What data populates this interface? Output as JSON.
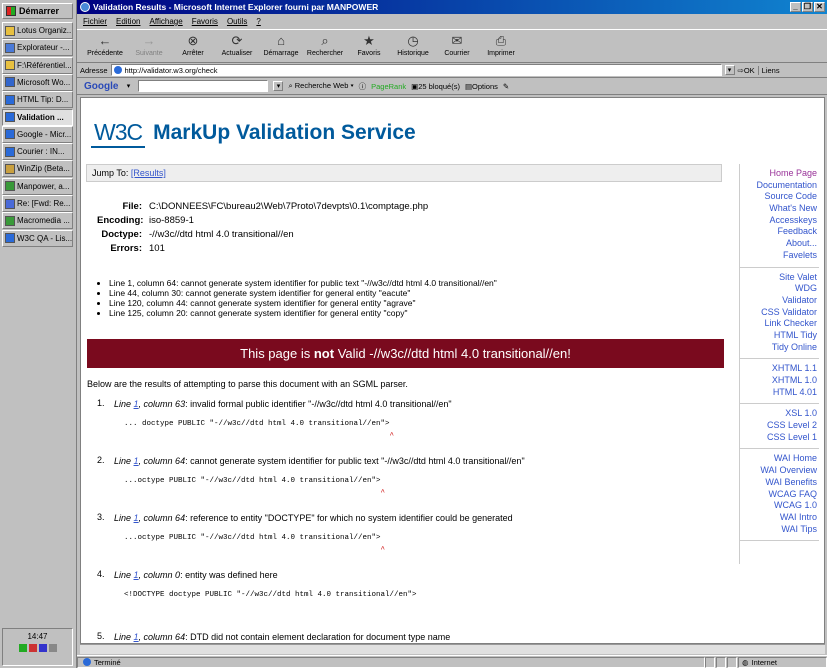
{
  "taskbar": {
    "start_label": "Démarrer",
    "items": [
      {
        "label": "Lotus Organiz..."
      },
      {
        "label": "Explorateur -..."
      },
      {
        "label": "F:\\Référentiel..."
      },
      {
        "label": "Microsoft Wo..."
      },
      {
        "label": "HTML Tip: D..."
      },
      {
        "label": "Validation ...",
        "active": true
      },
      {
        "label": "Google - Micr..."
      },
      {
        "label": "Courier : IN..."
      },
      {
        "label": "WinZip (Beta..."
      },
      {
        "label": "Manpower, a..."
      },
      {
        "label": "Re: [Fwd: Re..."
      },
      {
        "label": "Macromedia ..."
      },
      {
        "label": "W3C QA - Lis..."
      }
    ],
    "clock": "14:47"
  },
  "window": {
    "title": "Validation Results - Microsoft Internet Explorer fourni par MANPOWER",
    "menu": [
      "Fichier",
      "Edition",
      "Affichage",
      "Favoris",
      "Outils",
      "?"
    ],
    "toolbar": [
      {
        "label": "Précédente",
        "icon": "back-arrow-icon",
        "glyph": "←"
      },
      {
        "label": "Suivante",
        "icon": "forward-arrow-icon",
        "glyph": "→",
        "disabled": true
      },
      {
        "label": "Arrêter",
        "icon": "stop-icon",
        "glyph": "⊗"
      },
      {
        "label": "Actualiser",
        "icon": "refresh-icon",
        "glyph": "⟳"
      },
      {
        "label": "Démarrage",
        "icon": "home-icon",
        "glyph": "⌂"
      },
      {
        "label": "Rechercher",
        "icon": "search-icon",
        "glyph": "⌕"
      },
      {
        "label": "Favoris",
        "icon": "favorites-icon",
        "glyph": "★"
      },
      {
        "label": "Historique",
        "icon": "history-icon",
        "glyph": "◷"
      },
      {
        "label": "Courrier",
        "icon": "mail-icon",
        "glyph": "✉"
      },
      {
        "label": "Imprimer",
        "icon": "print-icon",
        "glyph": "⎙"
      }
    ],
    "address_label": "Adresse",
    "address_value": "http://validator.w3.org/check",
    "ok_label": "OK",
    "links_label": "Liens",
    "google_bar": {
      "logo": "Google",
      "search_web": "Recherche Web",
      "pagerank": "PageRank",
      "blocked": "25 bloqué(s)",
      "options": "Options"
    },
    "status": {
      "text": "Terminé",
      "zone": "Internet"
    }
  },
  "page": {
    "logo": "W3C",
    "title": "MarkUp Validation Service",
    "jump_to": "Jump To:",
    "results_link": "[Results]",
    "meta": [
      {
        "label": "File:",
        "value": "C:\\DONNEES\\FC\\bureau2\\Web\\7Proto\\7devpts\\0.1\\comptage.php"
      },
      {
        "label": "Encoding:",
        "value": "iso-8859-1"
      },
      {
        "label": "Doctype:",
        "value": "-//w3c//dtd html 4.0 transitional//en"
      },
      {
        "label": "Errors:",
        "value": "101"
      }
    ],
    "errors": [
      "Line 1, column 64: cannot generate system identifier for public text \"-//w3c//dtd html 4.0 transitional//en\"",
      "Line 44, column 30: cannot generate system identifier for general entity \"eacute\"",
      "Line 120, column 44: cannot generate system identifier for general entity \"agrave\"",
      "Line 125, column 20: cannot generate system identifier for general entity \"copy\""
    ],
    "invalid_pre": "This page is ",
    "invalid_bold": "not",
    "invalid_post": " Valid -//w3c//dtd html 4.0 transitional//en!",
    "intro": "Below are the results of attempting to parse this document with an SGML parser.",
    "results": [
      {
        "num": "1.",
        "line_label": "Line",
        "line": "1",
        "col": ", column 63",
        "msg": ": invalid formal public identifier \"-//w3c//dtd html 4.0 transitional//en\"",
        "code": "... doctype PUBLIC \"-//w3c//dtd html 4.0 transitional//en\">",
        "caret": "^"
      },
      {
        "num": "2.",
        "line_label": "Line",
        "line": "1",
        "col": ", column 64",
        "msg": ": cannot generate system identifier for public text \"-//w3c//dtd html 4.0 transitional//en\"",
        "code": "...octype PUBLIC \"-//w3c//dtd html 4.0 transitional//en\">",
        "caret": "^"
      },
      {
        "num": "3.",
        "line_label": "Line",
        "line": "1",
        "col": ", column 64",
        "msg": ": reference to entity \"DOCTYPE\" for which no system identifier could be generated",
        "code": "...octype PUBLIC \"-//w3c//dtd html 4.0 transitional//en\">",
        "caret": "^"
      },
      {
        "num": "4.",
        "line_label": "Line",
        "line": "1",
        "col": ", column 0",
        "msg": ": entity was defined here",
        "code": "<!DOCTYPE doctype PUBLIC \"-//w3c//dtd html 4.0 transitional//en\">",
        "caret": ""
      },
      {
        "num": "5.",
        "line_label": "Line",
        "line": "1",
        "col": ", column 64",
        "msg": ": DTD did not contain element declaration for document type name",
        "code": "",
        "caret": ""
      }
    ],
    "nav_groups": [
      [
        {
          "label": "Home Page",
          "color": "#993399"
        },
        {
          "label": "Documentation"
        },
        {
          "label": "Source Code"
        },
        {
          "label": "What's New"
        },
        {
          "label": "Accesskeys"
        },
        {
          "label": "Feedback"
        },
        {
          "label": "About..."
        },
        {
          "label": "Favelets"
        }
      ],
      [
        {
          "label": "Site Valet"
        },
        {
          "label": "WDG"
        },
        {
          "label": "Validator"
        },
        {
          "label": "CSS Validator"
        },
        {
          "label": "Link Checker"
        },
        {
          "label": "HTML Tidy"
        },
        {
          "label": "Tidy Online"
        }
      ],
      [
        {
          "label": "XHTML 1.1"
        },
        {
          "label": "XHTML 1.0"
        },
        {
          "label": "HTML 4.01"
        }
      ],
      [
        {
          "label": "XSL 1.0"
        },
        {
          "label": "CSS Level 2"
        },
        {
          "label": "CSS Level 1"
        }
      ],
      [
        {
          "label": "WAI Home"
        },
        {
          "label": "WAI Overview"
        },
        {
          "label": "WAI Benefits"
        },
        {
          "label": "WCAG FAQ"
        },
        {
          "label": "WCAG 1.0"
        },
        {
          "label": "WAI Intro"
        },
        {
          "label": "WAI Tips"
        }
      ]
    ],
    "colors": {
      "link": "#3355cc",
      "visited": "#993399",
      "banner": "#7a0a1e",
      "w3c_blue": "#005a9c"
    }
  }
}
